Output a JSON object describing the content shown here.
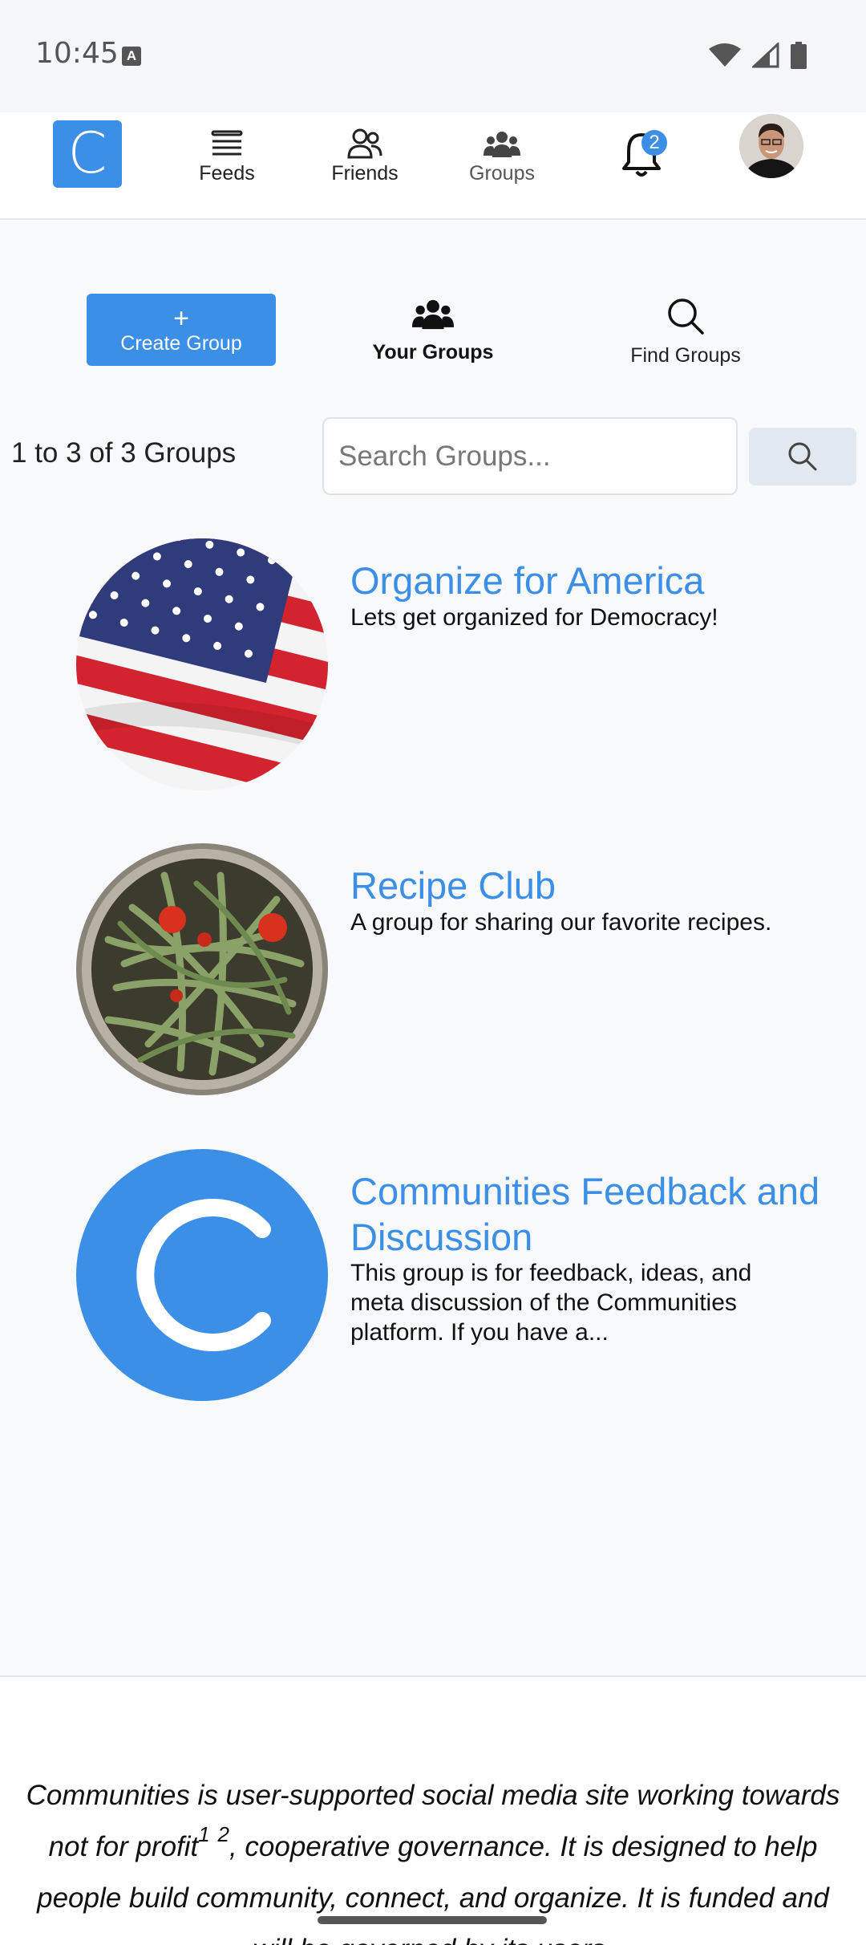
{
  "status": {
    "time": "10:45",
    "a_badge": "A"
  },
  "nav": {
    "logo": "C",
    "feeds": "Feeds",
    "friends": "Friends",
    "groups": "Groups",
    "notification_count": "2"
  },
  "actions": {
    "create_plus": "+",
    "create": "Create Group",
    "your_groups": "Your Groups",
    "find_groups": "Find Groups"
  },
  "search": {
    "count": "1 to 3 of 3 Groups",
    "placeholder": "Search Groups..."
  },
  "groups": [
    {
      "name": "Organize for America",
      "description": "Lets get organized for Democracy!"
    },
    {
      "name": "Recipe Club",
      "description": "A group for sharing our favorite recipes."
    },
    {
      "name": "Communities Feedback and Discussion",
      "description": "This group is for feedback, ideas, and meta discussion of the Communities platform. If you have a...",
      "avatar_letter": "C"
    }
  ],
  "footer": {
    "part1": "Communities is user-supported social media site working towards not for profit",
    "sup1": "1",
    "sup2": "2",
    "part2": ", cooperative governance. It is designed to help people build community, connect, and organize. It is funded and will be governed by its users."
  },
  "colors": {
    "accent": "#3b8fe6",
    "page_bg": "#f7f9fc"
  }
}
